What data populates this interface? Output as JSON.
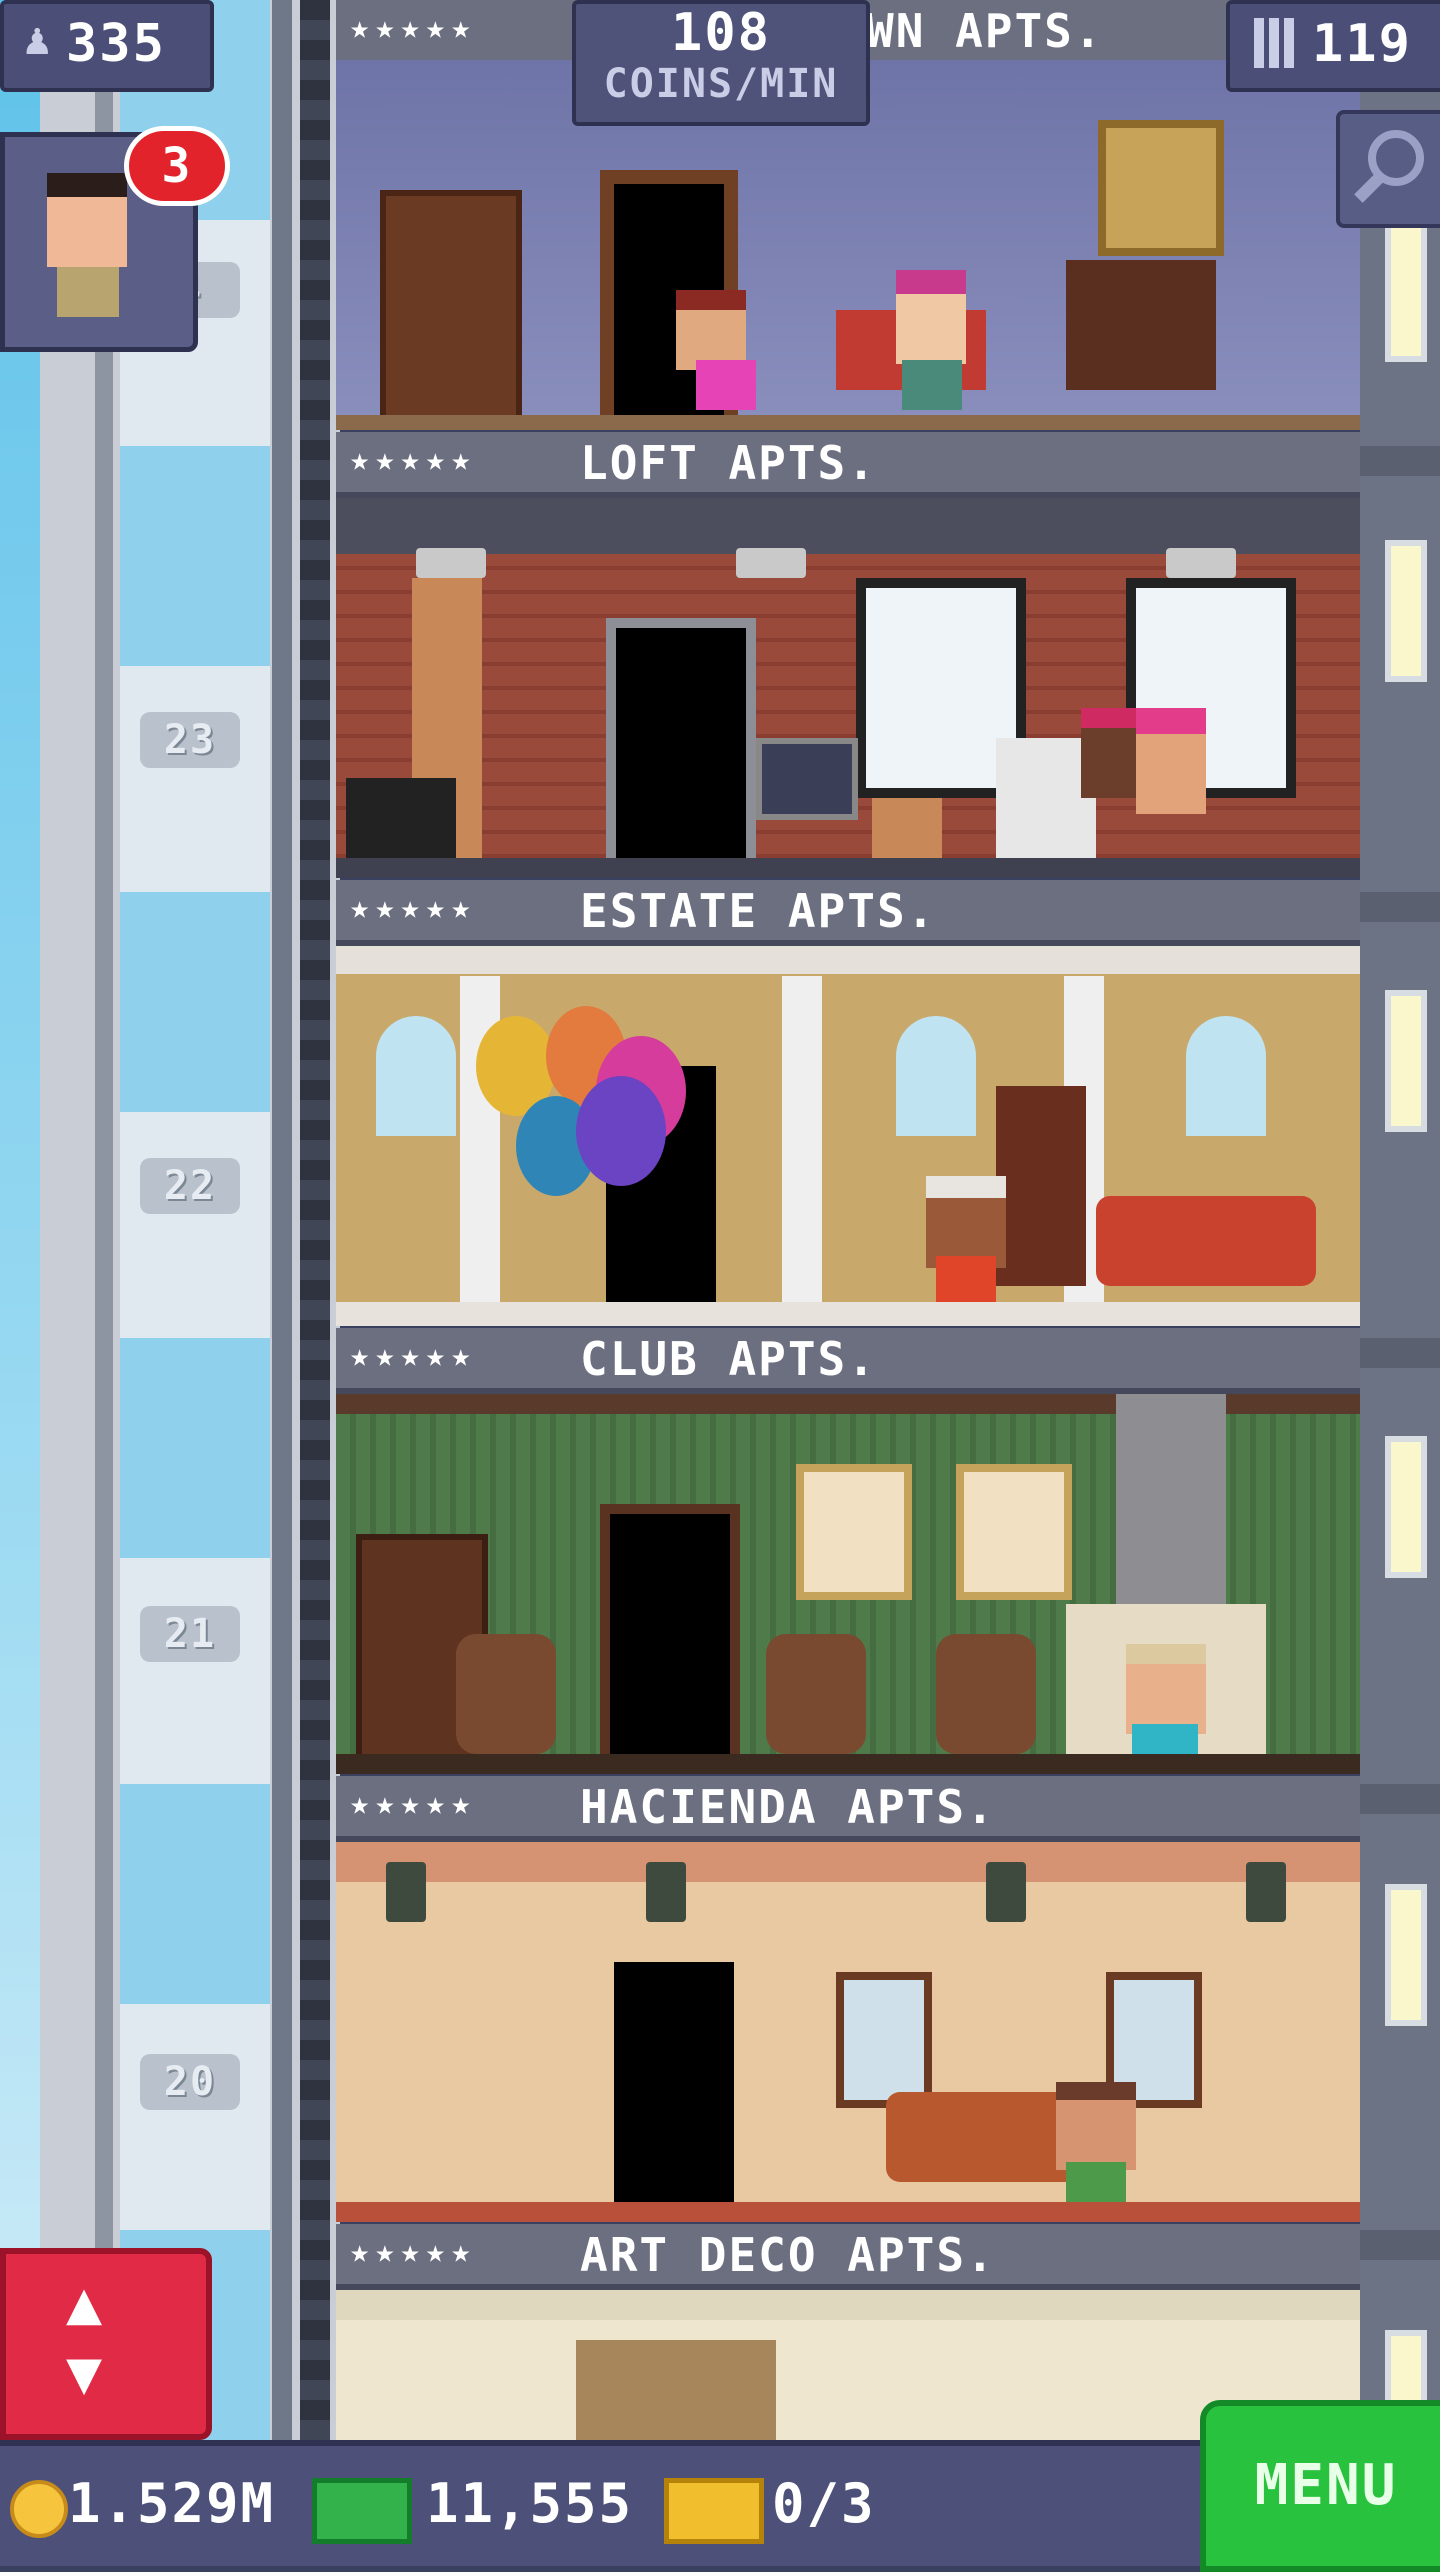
{
  "hud": {
    "population": "335",
    "coins_per_min_value": "108",
    "coins_per_min_unit": "COINS/MIN",
    "floor_count": "119"
  },
  "resident_notification": {
    "count": "3"
  },
  "floors": [
    {
      "name": "WN APTS.",
      "stars": "★★★★★",
      "shaft_number": ""
    },
    {
      "name": "LOFT APTS.",
      "stars": "★★★★★",
      "shaft_number": "23"
    },
    {
      "name": "ESTATE APTS.",
      "stars": "★★★★★",
      "shaft_number": "22"
    },
    {
      "name": "CLUB APTS.",
      "stars": "★★★★★",
      "shaft_number": "21"
    },
    {
      "name": "HACIENDA APTS.",
      "stars": "★★★★★",
      "shaft_number": "20"
    },
    {
      "name": "ART DECO APTS.",
      "stars": "★★★★★",
      "shaft_number": ""
    }
  ],
  "shaft_top_number": "4",
  "bottom_bar": {
    "coins": "1.529M",
    "bux": "11,555",
    "tickets": "0/3",
    "menu_label": "MENU"
  },
  "colors": {
    "elevator_button": "#e12a45",
    "menu_button": "#29c23e",
    "hud_panel": "#4b4f78"
  },
  "icons": [
    "population-icon",
    "floors-icon",
    "search-icon",
    "up-down-arrows-icon",
    "coin-icon",
    "bux-icon",
    "ticket-icon"
  ]
}
